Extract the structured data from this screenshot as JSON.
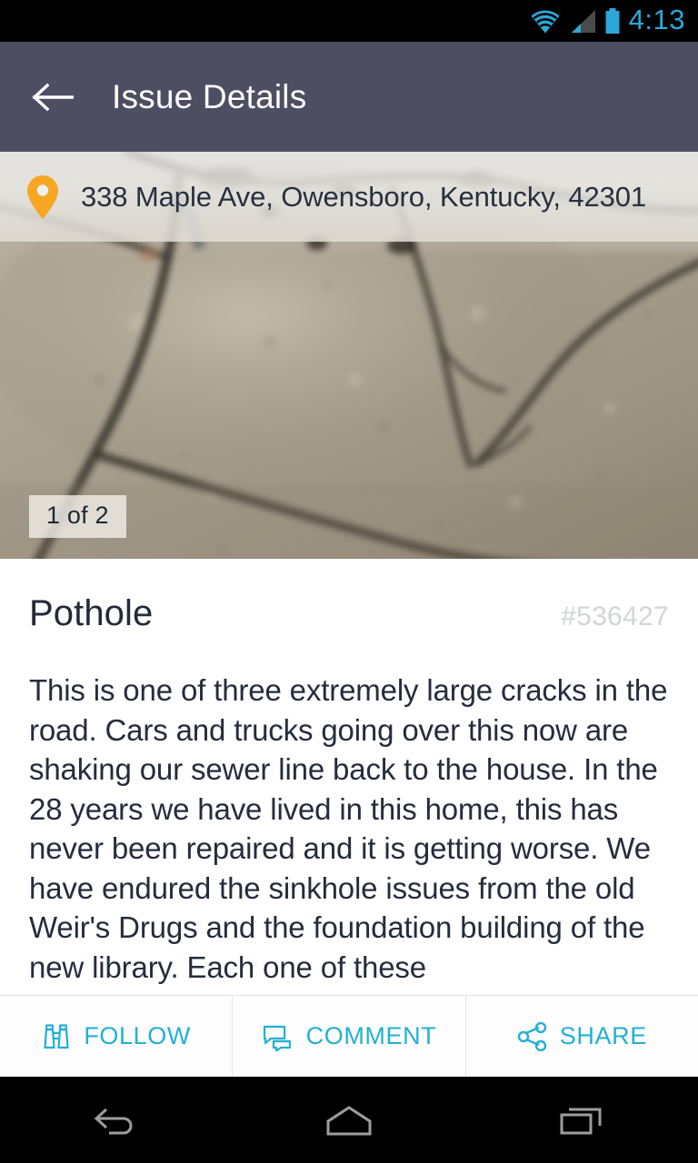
{
  "status_bar": {
    "time": "4:13",
    "icons": [
      "wifi-icon",
      "cellular-signal-icon",
      "battery-icon"
    ],
    "accent_color": "#2ca8d8",
    "background": "#000000"
  },
  "app_bar": {
    "title": "Issue Details",
    "back_icon": "back-arrow-icon",
    "background": "#4e4e63",
    "text_color": "#ffffff"
  },
  "photo": {
    "address": "338  Maple Ave, Owensboro, Kentucky, 42301",
    "pin_icon": "map-pin-icon",
    "pin_color": "#f5a623",
    "counter": "1 of 2",
    "alt": "blurred photo of large cracks in concrete pavement"
  },
  "issue": {
    "title": "Pothole",
    "id": "#536427",
    "description": "This is one of three extremely large cracks in the road. Cars and trucks going over this now are shaking our sewer line back to the house. In the 28 years we have lived in this home, this has never been repaired and it is getting worse. We have endured the sinkhole issues from the old Weir's Drugs and the foundation building of the new library. Each one of these"
  },
  "actions": {
    "accent_color": "#22b0d4",
    "buttons": [
      {
        "label": "FOLLOW",
        "icon": "binoculars-icon"
      },
      {
        "label": "COMMENT",
        "icon": "chat-bubbles-icon"
      },
      {
        "label": "SHARE",
        "icon": "share-nodes-icon"
      }
    ]
  },
  "nav_bar": {
    "buttons": [
      {
        "name": "android-back-button",
        "icon": "back-arrow-icon"
      },
      {
        "name": "android-home-button",
        "icon": "home-icon"
      },
      {
        "name": "android-recents-button",
        "icon": "recents-icon"
      }
    ]
  }
}
